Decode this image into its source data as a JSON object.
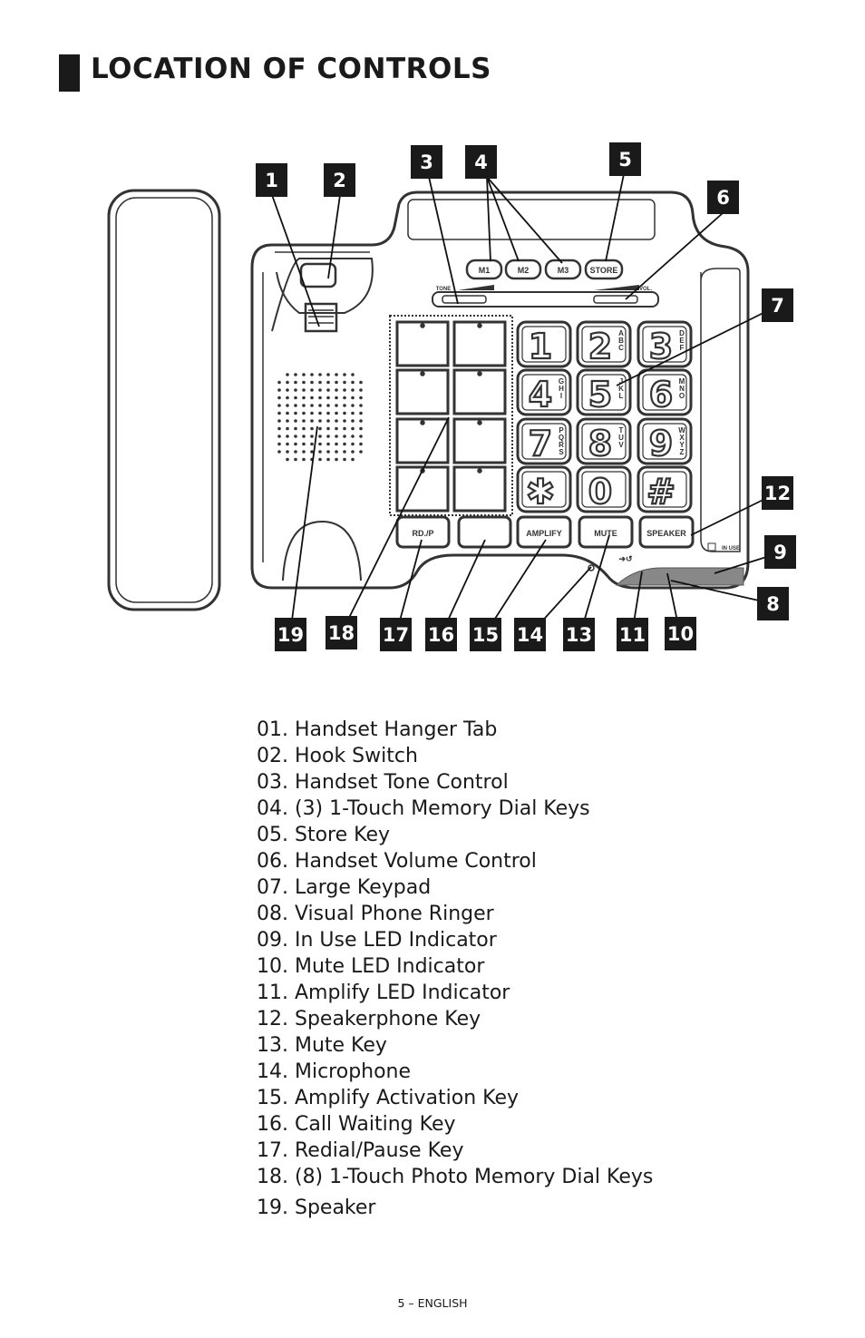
{
  "header": {
    "title": "LOCATION OF CONTROLS"
  },
  "diagram": {
    "memory_keys": [
      "M1",
      "M2",
      "M3",
      "STORE"
    ],
    "tone_label": "TONE",
    "vol_label": "VOL.",
    "keypad": [
      {
        "digit": "1",
        "letters": ""
      },
      {
        "digit": "2",
        "letters": "ABC"
      },
      {
        "digit": "3",
        "letters": "DEF"
      },
      {
        "digit": "4",
        "letters": "GHI"
      },
      {
        "digit": "5",
        "letters": "JKL"
      },
      {
        "digit": "6",
        "letters": "MNO"
      },
      {
        "digit": "7",
        "letters": "PQRS"
      },
      {
        "digit": "8",
        "letters": "TUV"
      },
      {
        "digit": "9",
        "letters": "WXYZ"
      },
      {
        "digit": "✱",
        "letters": ""
      },
      {
        "digit": "0",
        "letters": ""
      },
      {
        "digit": "#",
        "letters": ""
      }
    ],
    "bottom_keys": [
      "RD./P",
      "",
      "AMPLIFY",
      "MUTE",
      "SPEAKER"
    ],
    "in_use_label": "IN USE",
    "callouts": [
      "1",
      "2",
      "3",
      "4",
      "5",
      "6",
      "7",
      "8",
      "9",
      "10",
      "11",
      "12",
      "13",
      "14",
      "15",
      "16",
      "17",
      "18",
      "19"
    ]
  },
  "controls": [
    "01. Handset Hanger Tab",
    "02. Hook Switch",
    "03. Handset Tone Control",
    "04. (3) 1-Touch Memory Dial Keys",
    "05. Store Key",
    "06. Handset Volume Control",
    "07. Large Keypad",
    "08. Visual Phone Ringer",
    "09. In Use LED Indicator",
    "10. Mute LED Indicator",
    "11. Amplify LED Indicator",
    "12. Speakerphone Key",
    "13. Mute Key",
    "14. Microphone",
    "15. Amplify Activation Key",
    "16. Call Waiting Key",
    "17. Redial/Pause Key",
    "18. (8) 1-Touch Photo Memory Dial Keys",
    "19. Speaker"
  ],
  "footer": {
    "page": "5 – ENGLISH"
  }
}
